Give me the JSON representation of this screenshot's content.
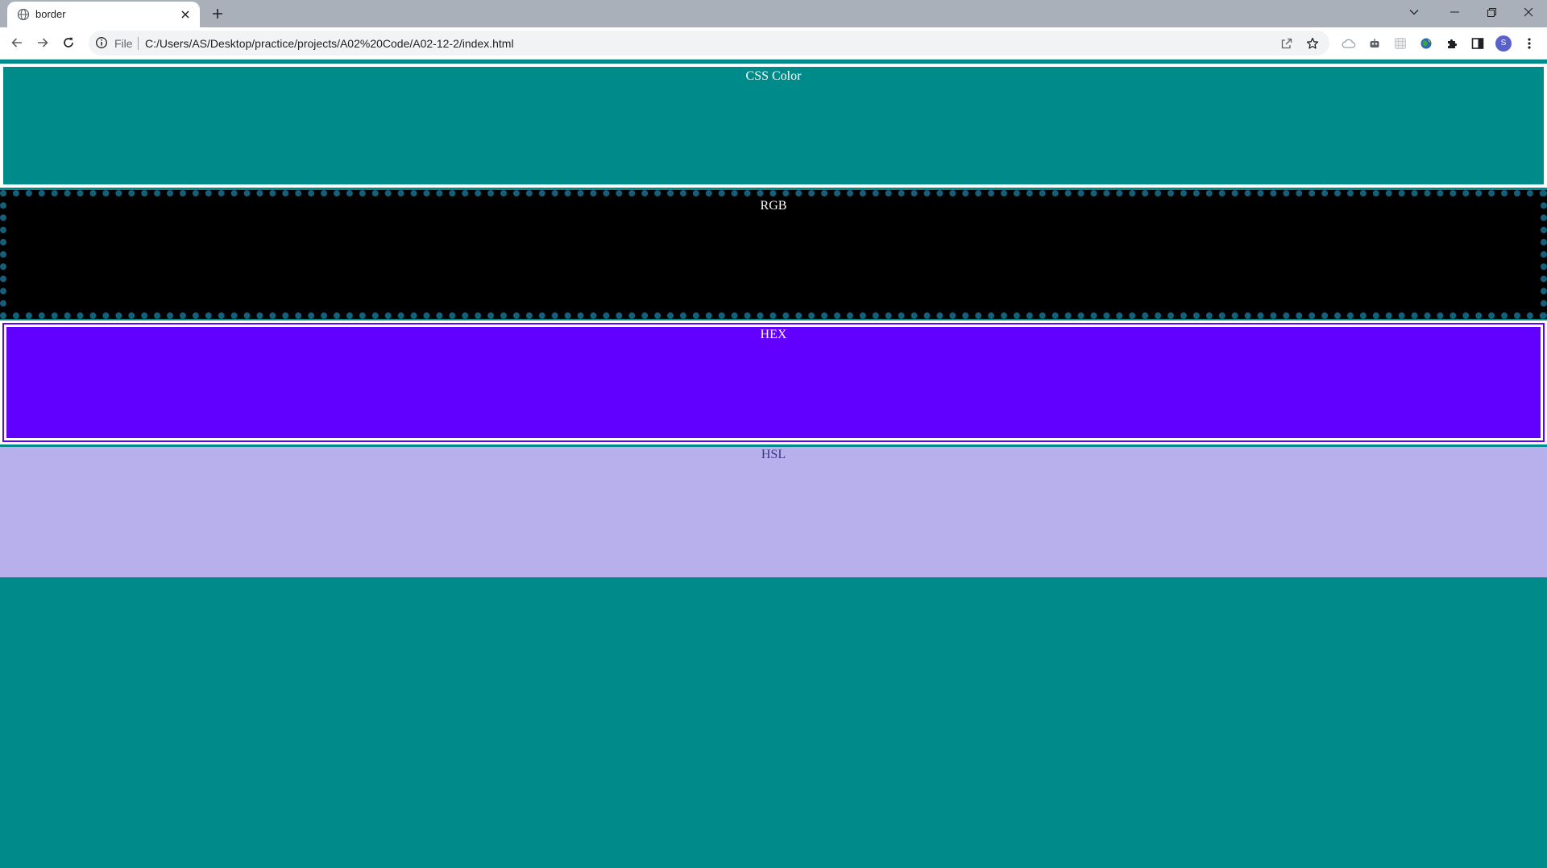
{
  "browser": {
    "tab": {
      "title": "border",
      "favicon": "globe-icon",
      "close": "close-icon"
    },
    "new_tab": "plus-icon",
    "window_controls": [
      "tab-search-icon",
      "minimize-icon",
      "restore-icon",
      "close-icon"
    ],
    "toolbar": {
      "back": "arrow-left-icon",
      "forward": "arrow-right-icon",
      "reload": "reload-icon"
    },
    "omnibox": {
      "info_icon": "info-icon",
      "scheme": "File",
      "url": "C:/Users/AS/Desktop/practice/projects/A02%20Code/A02-12-2/index.html",
      "share": "share-icon",
      "bookmark": "star-icon"
    },
    "extensions": [
      "cloud-icon",
      "robot-icon",
      "extension-grid-icon",
      "globe-leaf-icon",
      "puzzle-icon",
      "side-panel-icon"
    ],
    "profile_initial": "S",
    "menu": "kebab-menu-icon"
  },
  "page": {
    "background": "#008b8b",
    "sections": [
      {
        "label": "CSS Color",
        "background": "#008b8b",
        "border": "solid white"
      },
      {
        "label": "RGB",
        "background": "#000000",
        "border": "dotted teal"
      },
      {
        "label": "HEX",
        "background": "#6200ff",
        "border": "double white"
      },
      {
        "label": "HSL",
        "background": "#b8b0ec",
        "border": "none"
      }
    ]
  }
}
